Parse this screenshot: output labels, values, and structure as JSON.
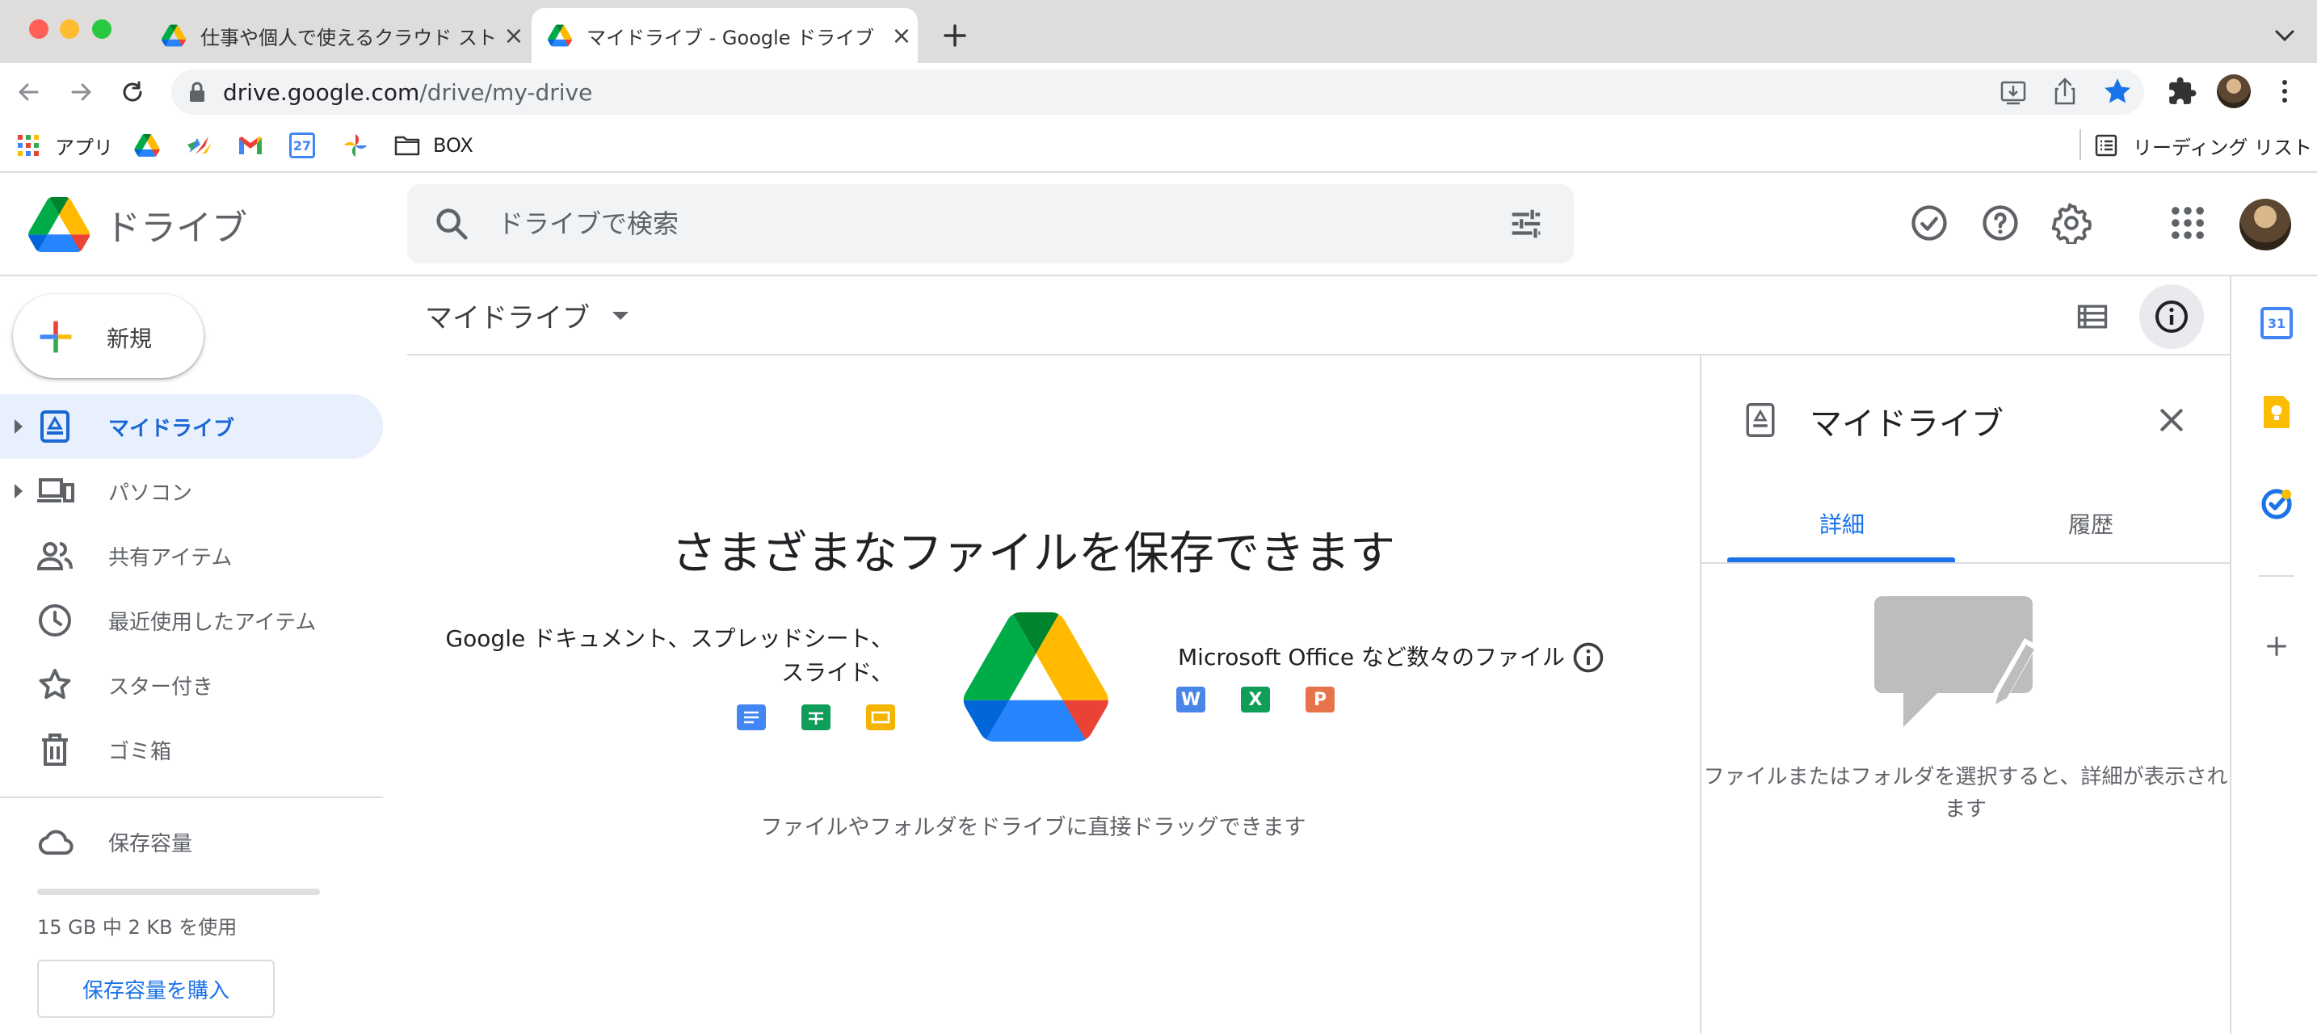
{
  "browser": {
    "tabs": [
      {
        "title": "仕事や個人で使えるクラウド スト",
        "active": false
      },
      {
        "title": "マイドライブ - Google ドライブ",
        "active": true
      }
    ],
    "url_host": "drive.google.com",
    "url_path": "/drive/my-drive",
    "bookmarks": {
      "apps_label": "アプリ",
      "box_label": "BOX",
      "reading_list_label": "リーディング リスト",
      "calendar_badge": "27"
    }
  },
  "header": {
    "product_name": "ドライブ",
    "search_placeholder": "ドライブで検索"
  },
  "sidebar": {
    "new_label": "新規",
    "items": [
      {
        "label": "マイドライブ",
        "icon": "my-drive-icon",
        "selected": true
      },
      {
        "label": "パソコン",
        "icon": "computers-icon"
      },
      {
        "label": "共有アイテム",
        "icon": "shared-people-icon"
      },
      {
        "label": "最近使用したアイテム",
        "icon": "clock-icon"
      },
      {
        "label": "スター付き",
        "icon": "star-icon"
      },
      {
        "label": "ゴミ箱",
        "icon": "trash-icon"
      }
    ],
    "storage": {
      "label": "保存容量",
      "usage_text": "15 GB 中 2 KB を使用",
      "used_fraction": 0.0,
      "buy_label": "保存容量を購入"
    }
  },
  "main": {
    "title": "マイドライブ",
    "empty_state": {
      "title": "さまざまなファイルを保存できます",
      "left_text": "Google ドキュメント、スプレッドシート、スライド、",
      "right_text": "Microsoft Office など数々のファイル",
      "drag_hint": "ファイルやフォルダをドライブに直接ドラッグできます",
      "office_letters": {
        "word": "W",
        "excel": "X",
        "powerpoint": "P"
      }
    }
  },
  "details_panel": {
    "title": "マイドライブ",
    "tabs": [
      "詳細",
      "履歴"
    ],
    "active_tab": 0,
    "empty_message": "ファイルまたはフォルダを選択すると、詳細が表示されます"
  },
  "right_rail": {
    "calendar_day": "31"
  },
  "colors": {
    "blue": "#1a73e8",
    "green": "#34a853",
    "yellow": "#fbbc04",
    "red": "#ea4335",
    "selected_bg": "#e8f0fe"
  }
}
